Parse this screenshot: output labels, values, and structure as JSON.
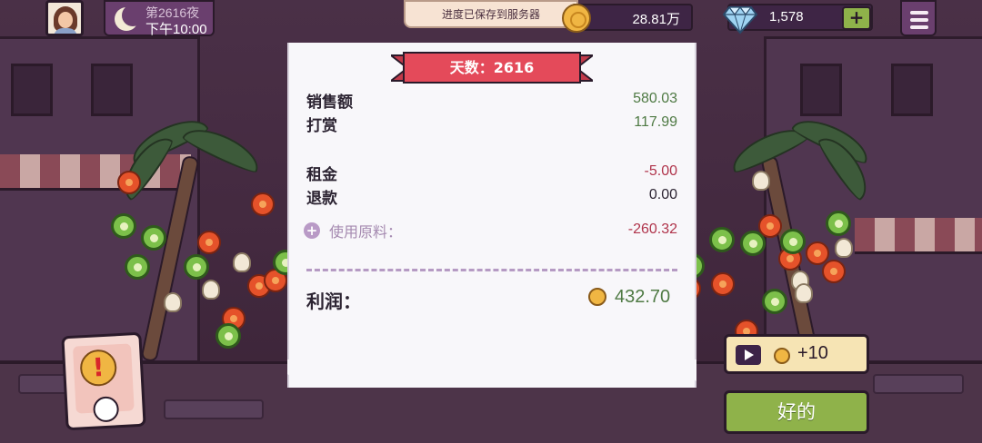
{
  "header": {
    "night_label": "第2616夜",
    "time_label": "下午10:00",
    "toast": "进度已保存到服务器",
    "coins": "28.81万",
    "gems": "1,578",
    "gem_plus": "+"
  },
  "receipt": {
    "day_banner": "天数：2616",
    "rows": [
      {
        "label": "销售额",
        "value": "580.03",
        "color": "#4f7a44"
      },
      {
        "label": "打赏",
        "value": "117.99",
        "color": "#4f7a44"
      },
      {
        "label": "租金",
        "value": "-5.00",
        "color": "#b0344b"
      },
      {
        "label": "退款",
        "value": "0.00",
        "color": "#2c2432"
      }
    ],
    "materials_label": "使用原料：",
    "materials_value": "-260.32",
    "profit_label": "利润：",
    "profit_value": "432.70"
  },
  "buttons": {
    "ad_reward": "+10",
    "ok": "好的"
  },
  "icons": {
    "avatar": "player-avatar",
    "moon": "moon-icon",
    "coin": "coin-icon",
    "gem": "diamond-icon",
    "menu": "menu-icon",
    "play": "video-play-icon",
    "alert": "exclamation-icon"
  },
  "colors": {
    "accent_green": "#8fb24a",
    "banner_red": "#e44a5a",
    "gem_plus_green": "#8fb24a"
  }
}
